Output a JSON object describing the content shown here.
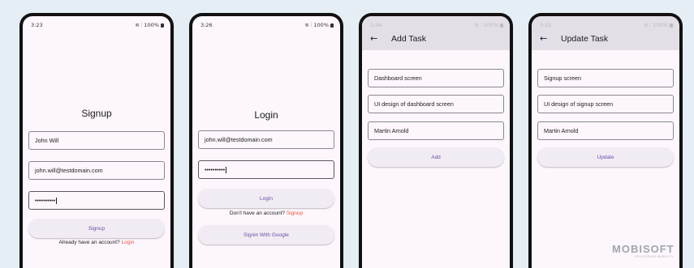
{
  "signup": {
    "status_time": "3:23",
    "status_right": "100%",
    "title": "Signup",
    "name_value": "John Will",
    "email_value": "john.will@testdomain.com",
    "password_value": "••••••••••",
    "button_label": "Signup",
    "helper_text": "Already have an account?",
    "helper_link": "Login"
  },
  "login": {
    "status_time": "3:26",
    "status_right": "100%",
    "title": "Login",
    "email_value": "john.will@testdomain.com",
    "password_value": "••••••••••",
    "button_label": "Login",
    "helper_text": "Don't have an account?",
    "helper_link": "Signup",
    "google_button_label": "Signin With Google"
  },
  "add_task": {
    "status_time": "2:46",
    "status_right": "100%",
    "title": "Add Task",
    "task_title_value": "Dashboard screen",
    "description_value": "UI design of dashboard screen",
    "assignee_value": "Martin Arnold",
    "button_label": "Add"
  },
  "update_task": {
    "status_time": "3:02",
    "status_right": "100%",
    "title": "Update Task",
    "task_title_value": "Signup screen",
    "description_value": "UI design of signup screen",
    "assignee_value": "Martin Arnold",
    "button_label": "Update"
  },
  "brand": {
    "logo_text": "MOBISOFT",
    "logo_tagline": "DELIVERING MOBILITY"
  },
  "icons": {
    "back": "arrow-left-icon",
    "wifi": "wifi-icon",
    "signal": "signal-icon",
    "battery": "battery-icon"
  }
}
